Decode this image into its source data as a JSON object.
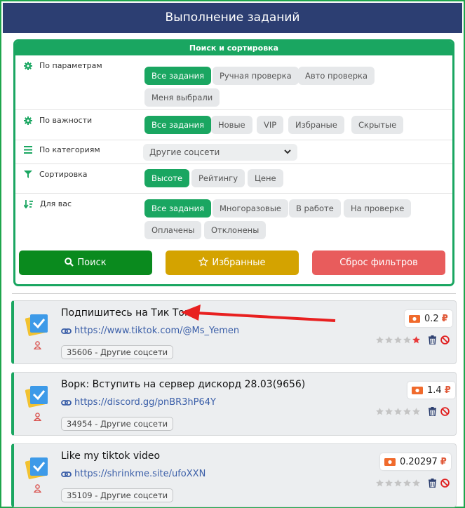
{
  "header": {
    "title": "Выполнение заданий"
  },
  "panel": {
    "title": "Поиск и сортировка",
    "rows": [
      {
        "label": "По параметрам",
        "chips": [
          "Все задания",
          "Ручная проверка",
          "Авто проверка",
          "Меня выбрали"
        ]
      },
      {
        "label": "По важности",
        "chips": [
          "Все задания",
          "Новые",
          "VIP",
          "Избраные",
          "Скрытые"
        ]
      },
      {
        "label": "По категориям",
        "select": "Другие соцсети"
      },
      {
        "label": "Сортировка",
        "chips": [
          "Высоте",
          "Рейтингу",
          "Цене"
        ]
      },
      {
        "label": "Для вас",
        "chips": [
          "Все задания",
          "Многоразовые",
          "В работе",
          "На проверке",
          "Оплачены",
          "Отклонены"
        ]
      }
    ],
    "buttons": {
      "search": "Поиск",
      "favorites": "Избранные",
      "reset": "Сброс фильтров"
    }
  },
  "tasks": [
    {
      "title": "Подпишитесь на Тик Ток",
      "url": "https://www.tiktok.com/@Ms_Yemen",
      "tag": "35606 - Другие соцсети",
      "price": "0.2"
    },
    {
      "title": "Ворк: Вступить на сервер дискорд 28.03(9656)",
      "url": "https://discord.gg/pnBR3hP64Y",
      "tag": "34954 - Другие соцсети",
      "price": "1.4"
    },
    {
      "title": "Like my tiktok video",
      "url": "https://shrinkme.site/ufoXXN",
      "tag": "35109 - Другие соцсети",
      "price": "0.20297"
    }
  ],
  "currency": "₽",
  "colors": {
    "accent": "#1aa661",
    "header": "#2c3e72",
    "search": "#0a8a1e",
    "favorites": "#d4a300",
    "reset": "#e85c5c",
    "arrow": "#e82020"
  }
}
